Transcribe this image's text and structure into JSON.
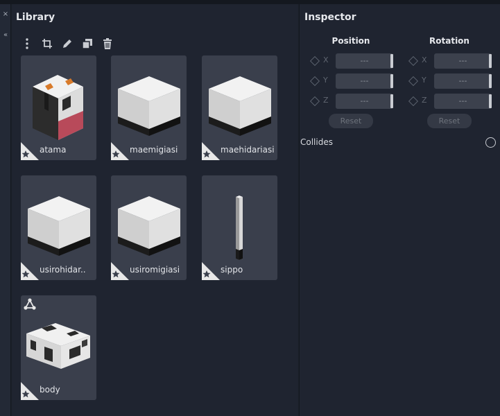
{
  "side": {
    "close_glyph": "×",
    "collapse_glyph": "«"
  },
  "library": {
    "title": "Library",
    "toolbar": [
      "more-vertical-icon",
      "crop-icon",
      "pencil-icon",
      "duplicate-icon",
      "trash-icon"
    ],
    "items": [
      {
        "label": "atama",
        "thumb": "cow-head"
      },
      {
        "label": "maemigiasi",
        "thumb": "white-block"
      },
      {
        "label": "maehidariasi",
        "thumb": "white-block"
      },
      {
        "label": "usirohidar..",
        "thumb": "white-block"
      },
      {
        "label": "usiromigiasi",
        "thumb": "white-block"
      },
      {
        "label": "sippo",
        "thumb": "tail-stick"
      },
      {
        "label": "body",
        "thumb": "cow-body"
      }
    ]
  },
  "inspector": {
    "title": "Inspector",
    "position": {
      "heading": "Position",
      "rows": [
        {
          "axis": "X",
          "value": "---"
        },
        {
          "axis": "Y",
          "value": "---"
        },
        {
          "axis": "Z",
          "value": "---"
        }
      ],
      "reset_label": "Reset"
    },
    "rotation": {
      "heading": "Rotation",
      "rows": [
        {
          "axis": "X",
          "value": "---"
        },
        {
          "axis": "Y",
          "value": "---"
        },
        {
          "axis": "Z",
          "value": "---"
        }
      ],
      "reset_label": "Reset"
    },
    "collides_label": "Collides"
  },
  "colors": {
    "panel": "#1f2430",
    "card": "#3a3f4c",
    "field": "#3c414d",
    "accent_text": "#e6e8ec"
  }
}
